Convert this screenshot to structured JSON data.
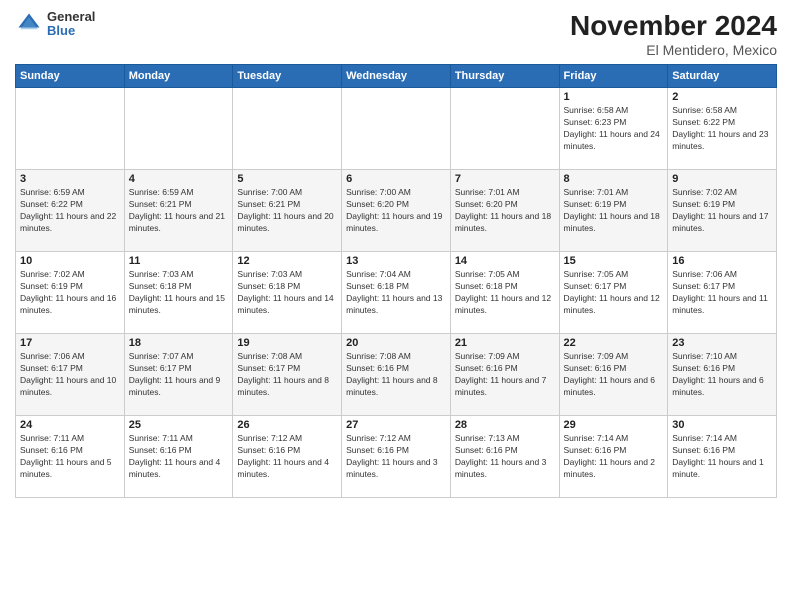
{
  "header": {
    "logo": {
      "general": "General",
      "blue": "Blue"
    },
    "title": "November 2024",
    "location": "El Mentidero, Mexico"
  },
  "weekdays": [
    "Sunday",
    "Monday",
    "Tuesday",
    "Wednesday",
    "Thursday",
    "Friday",
    "Saturday"
  ],
  "weeks": [
    [
      {
        "day": "",
        "info": ""
      },
      {
        "day": "",
        "info": ""
      },
      {
        "day": "",
        "info": ""
      },
      {
        "day": "",
        "info": ""
      },
      {
        "day": "",
        "info": ""
      },
      {
        "day": "1",
        "info": "Sunrise: 6:58 AM\nSunset: 6:23 PM\nDaylight: 11 hours and 24 minutes."
      },
      {
        "day": "2",
        "info": "Sunrise: 6:58 AM\nSunset: 6:22 PM\nDaylight: 11 hours and 23 minutes."
      }
    ],
    [
      {
        "day": "3",
        "info": "Sunrise: 6:59 AM\nSunset: 6:22 PM\nDaylight: 11 hours and 22 minutes."
      },
      {
        "day": "4",
        "info": "Sunrise: 6:59 AM\nSunset: 6:21 PM\nDaylight: 11 hours and 21 minutes."
      },
      {
        "day": "5",
        "info": "Sunrise: 7:00 AM\nSunset: 6:21 PM\nDaylight: 11 hours and 20 minutes."
      },
      {
        "day": "6",
        "info": "Sunrise: 7:00 AM\nSunset: 6:20 PM\nDaylight: 11 hours and 19 minutes."
      },
      {
        "day": "7",
        "info": "Sunrise: 7:01 AM\nSunset: 6:20 PM\nDaylight: 11 hours and 18 minutes."
      },
      {
        "day": "8",
        "info": "Sunrise: 7:01 AM\nSunset: 6:19 PM\nDaylight: 11 hours and 18 minutes."
      },
      {
        "day": "9",
        "info": "Sunrise: 7:02 AM\nSunset: 6:19 PM\nDaylight: 11 hours and 17 minutes."
      }
    ],
    [
      {
        "day": "10",
        "info": "Sunrise: 7:02 AM\nSunset: 6:19 PM\nDaylight: 11 hours and 16 minutes."
      },
      {
        "day": "11",
        "info": "Sunrise: 7:03 AM\nSunset: 6:18 PM\nDaylight: 11 hours and 15 minutes."
      },
      {
        "day": "12",
        "info": "Sunrise: 7:03 AM\nSunset: 6:18 PM\nDaylight: 11 hours and 14 minutes."
      },
      {
        "day": "13",
        "info": "Sunrise: 7:04 AM\nSunset: 6:18 PM\nDaylight: 11 hours and 13 minutes."
      },
      {
        "day": "14",
        "info": "Sunrise: 7:05 AM\nSunset: 6:18 PM\nDaylight: 11 hours and 12 minutes."
      },
      {
        "day": "15",
        "info": "Sunrise: 7:05 AM\nSunset: 6:17 PM\nDaylight: 11 hours and 12 minutes."
      },
      {
        "day": "16",
        "info": "Sunrise: 7:06 AM\nSunset: 6:17 PM\nDaylight: 11 hours and 11 minutes."
      }
    ],
    [
      {
        "day": "17",
        "info": "Sunrise: 7:06 AM\nSunset: 6:17 PM\nDaylight: 11 hours and 10 minutes."
      },
      {
        "day": "18",
        "info": "Sunrise: 7:07 AM\nSunset: 6:17 PM\nDaylight: 11 hours and 9 minutes."
      },
      {
        "day": "19",
        "info": "Sunrise: 7:08 AM\nSunset: 6:17 PM\nDaylight: 11 hours and 8 minutes."
      },
      {
        "day": "20",
        "info": "Sunrise: 7:08 AM\nSunset: 6:16 PM\nDaylight: 11 hours and 8 minutes."
      },
      {
        "day": "21",
        "info": "Sunrise: 7:09 AM\nSunset: 6:16 PM\nDaylight: 11 hours and 7 minutes."
      },
      {
        "day": "22",
        "info": "Sunrise: 7:09 AM\nSunset: 6:16 PM\nDaylight: 11 hours and 6 minutes."
      },
      {
        "day": "23",
        "info": "Sunrise: 7:10 AM\nSunset: 6:16 PM\nDaylight: 11 hours and 6 minutes."
      }
    ],
    [
      {
        "day": "24",
        "info": "Sunrise: 7:11 AM\nSunset: 6:16 PM\nDaylight: 11 hours and 5 minutes."
      },
      {
        "day": "25",
        "info": "Sunrise: 7:11 AM\nSunset: 6:16 PM\nDaylight: 11 hours and 4 minutes."
      },
      {
        "day": "26",
        "info": "Sunrise: 7:12 AM\nSunset: 6:16 PM\nDaylight: 11 hours and 4 minutes."
      },
      {
        "day": "27",
        "info": "Sunrise: 7:12 AM\nSunset: 6:16 PM\nDaylight: 11 hours and 3 minutes."
      },
      {
        "day": "28",
        "info": "Sunrise: 7:13 AM\nSunset: 6:16 PM\nDaylight: 11 hours and 3 minutes."
      },
      {
        "day": "29",
        "info": "Sunrise: 7:14 AM\nSunset: 6:16 PM\nDaylight: 11 hours and 2 minutes."
      },
      {
        "day": "30",
        "info": "Sunrise: 7:14 AM\nSunset: 6:16 PM\nDaylight: 11 hours and 1 minute."
      }
    ]
  ]
}
